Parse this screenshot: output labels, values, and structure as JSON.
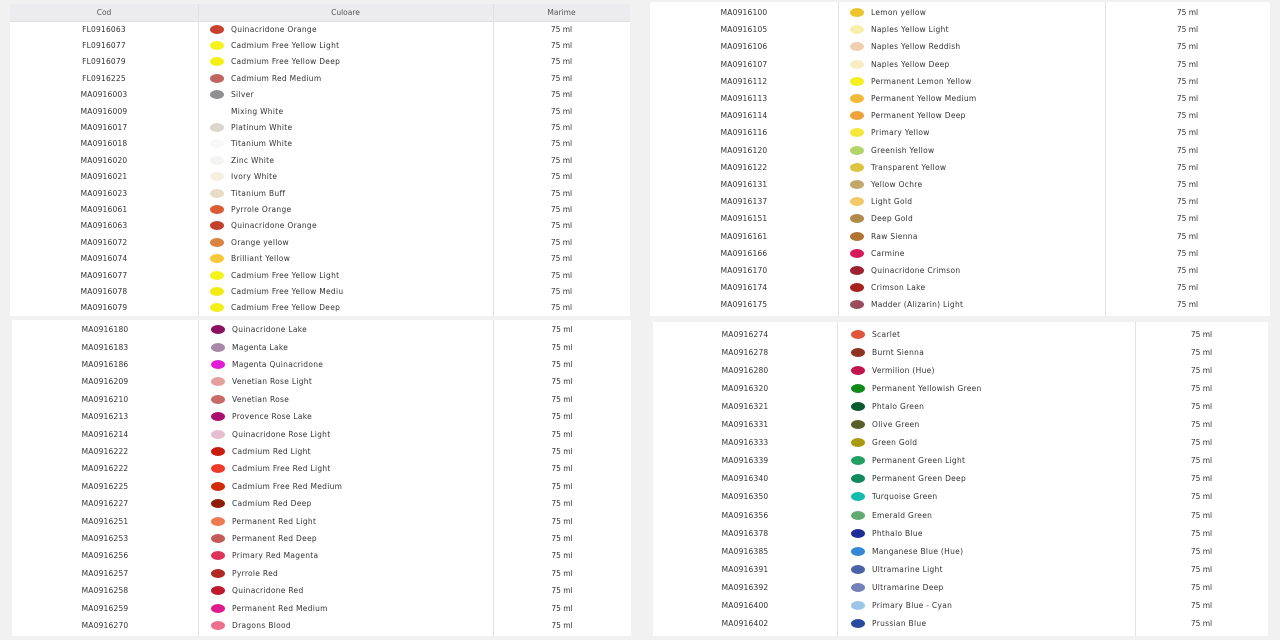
{
  "header": {
    "cod": "Cod",
    "culoare": "Culoare",
    "marime": "Marime"
  },
  "panels": [
    {
      "rows": [
        {
          "cod": "FL0916063",
          "name": "Quinacridone Orange",
          "size": "75 ml",
          "color": "#c8402e"
        },
        {
          "cod": "FL0916077",
          "name": "Cadmium Free Yellow Light",
          "size": "75 ml",
          "color": "#f6f21c"
        },
        {
          "cod": "FL0916079",
          "name": "Cadmium Free Yellow Deep",
          "size": "75 ml",
          "color": "#f4f016"
        },
        {
          "cod": "FL0916225",
          "name": "Cadmium Red Medium",
          "size": "75 ml",
          "color": "#bf6460"
        },
        {
          "cod": "MA0916003",
          "name": "Silver",
          "size": "75 ml",
          "color": "#8f8f93"
        },
        {
          "cod": "MA0916009",
          "name": "Mixing White",
          "size": "75 ml",
          "color": "#ffffff"
        },
        {
          "cod": "MA0916017",
          "name": "Platinum White",
          "size": "75 ml",
          "color": "#dcd6cc"
        },
        {
          "cod": "MA0916018",
          "name": "Titanium White",
          "size": "75 ml",
          "color": "#f8f8f8"
        },
        {
          "cod": "MA0916020",
          "name": "Zinc White",
          "size": "75 ml",
          "color": "#f3f3f1"
        },
        {
          "cod": "MA0916021",
          "name": "Ivory White",
          "size": "75 ml",
          "color": "#f6eee0"
        },
        {
          "cod": "MA0916023",
          "name": "Titanium Buff",
          "size": "75 ml",
          "color": "#e8dcc4"
        },
        {
          "cod": "MA0916061",
          "name": "Pyrrole Orange",
          "size": "75 ml",
          "color": "#dc5a36"
        },
        {
          "cod": "MA0916063",
          "name": "Quinacridone Orange",
          "size": "75 ml",
          "color": "#c2402c"
        },
        {
          "cod": "MA0916072",
          "name": "Orange yellow",
          "size": "75 ml",
          "color": "#d98440"
        },
        {
          "cod": "MA0916074",
          "name": "Brilliant Yellow",
          "size": "75 ml",
          "color": "#f8c838"
        },
        {
          "cod": "MA0916077",
          "name": "Cadmium Free Yellow Light",
          "size": "75 ml",
          "color": "#f6f21c"
        },
        {
          "cod": "MA0916078",
          "name": "Cadmium Free Yellow Mediu",
          "size": "75 ml",
          "color": "#f2ea14"
        },
        {
          "cod": "MA0916079",
          "name": "Cadmium Free Yellow Deep",
          "size": "75 ml",
          "color": "#f4ee18"
        }
      ]
    },
    {
      "rows": [
        {
          "cod": "MA0916100",
          "name": "Lemon yellow",
          "size": "75 ml",
          "color": "#ebc62a"
        },
        {
          "cod": "MA0916105",
          "name": "Naples Yellow Light",
          "size": "75 ml",
          "color": "#f8f0a8"
        },
        {
          "cod": "MA0916106",
          "name": "Naples Yellow Reddish",
          "size": "75 ml",
          "color": "#f0ceb0"
        },
        {
          "cod": "MA0916107",
          "name": "Naples Yellow Deep",
          "size": "75 ml",
          "color": "#f8ecc4"
        },
        {
          "cod": "MA0916112",
          "name": "Permanent Lemon Yellow",
          "size": "75 ml",
          "color": "#f5ee20"
        },
        {
          "cod": "MA0916113",
          "name": "Permanent Yellow Medium",
          "size": "75 ml",
          "color": "#f2b83a"
        },
        {
          "cod": "MA0916114",
          "name": "Permanent Yellow Deep",
          "size": "75 ml",
          "color": "#f0a23a"
        },
        {
          "cod": "MA0916116",
          "name": "Primary Yellow",
          "size": "75 ml",
          "color": "#f6e83a"
        },
        {
          "cod": "MA0916120",
          "name": "Greenish Yellow",
          "size": "75 ml",
          "color": "#b2d46a"
        },
        {
          "cod": "MA0916122",
          "name": "Transparent Yellow",
          "size": "75 ml",
          "color": "#dcc440"
        },
        {
          "cod": "MA0916131",
          "name": "Yellow Ochre",
          "size": "75 ml",
          "color": "#c2a86a"
        },
        {
          "cod": "MA0916137",
          "name": "Light Gold",
          "size": "75 ml",
          "color": "#f2c868"
        },
        {
          "cod": "MA0916151",
          "name": "Deep Gold",
          "size": "75 ml",
          "color": "#b08a48"
        },
        {
          "cod": "MA0916161",
          "name": "Raw Sienna",
          "size": "75 ml",
          "color": "#b07432"
        },
        {
          "cod": "MA0916166",
          "name": "Carmine",
          "size": "75 ml",
          "color": "#d41a5a"
        },
        {
          "cod": "MA0916170",
          "name": "Quinacridone Crimson",
          "size": "75 ml",
          "color": "#9c2230"
        },
        {
          "cod": "MA0916174",
          "name": "Crimson Lake",
          "size": "75 ml",
          "color": "#a8221c"
        },
        {
          "cod": "MA0916175",
          "name": "Madder (Alizarin) Light",
          "size": "75 ml",
          "color": "#9a4c5c"
        }
      ]
    },
    {
      "rows": [
        {
          "cod": "MA0916180",
          "name": "Quinacridone Lake",
          "size": "75 ml",
          "color": "#8c1060"
        },
        {
          "cod": "MA0916183",
          "name": "Magenta Lake",
          "size": "75 ml",
          "color": "#a888a8"
        },
        {
          "cod": "MA0916186",
          "name": "Magenta Quinacridone",
          "size": "75 ml",
          "color": "#e01cd8"
        },
        {
          "cod": "MA0916209",
          "name": "Venetian Rose Light",
          "size": "75 ml",
          "color": "#e4a09c"
        },
        {
          "cod": "MA0916210",
          "name": "Venetian Rose",
          "size": "75 ml",
          "color": "#c86a66"
        },
        {
          "cod": "MA0916213",
          "name": "Provence Rose Lake",
          "size": "75 ml",
          "color": "#a81070"
        },
        {
          "cod": "MA0916214",
          "name": "Quinacridone Rose Light",
          "size": "75 ml",
          "color": "#e8bcd0"
        },
        {
          "cod": "MA0916222",
          "name": "Cadmium Red Light",
          "size": "75 ml",
          "color": "#c81c0e"
        },
        {
          "cod": "MA0916222",
          "name": "Cadmium Free Red Light",
          "size": "75 ml",
          "color": "#ee3a28"
        },
        {
          "cod": "MA0916225",
          "name": "Cadmium Free Red Medium",
          "size": "75 ml",
          "color": "#d02a08"
        },
        {
          "cod": "MA0916227",
          "name": "Cadmium Red Deep",
          "size": "75 ml",
          "color": "#8e1e06"
        },
        {
          "cod": "MA0916251",
          "name": "Permanent Red Light",
          "size": "75 ml",
          "color": "#ee7a52"
        },
        {
          "cod": "MA0916253",
          "name": "Permanent Red Deep",
          "size": "75 ml",
          "color": "#c45a58"
        },
        {
          "cod": "MA0916256",
          "name": "Primary Red Magenta",
          "size": "75 ml",
          "color": "#dc3456"
        },
        {
          "cod": "MA0916257",
          "name": "Pyrrole Red",
          "size": "75 ml",
          "color": "#b02a24"
        },
        {
          "cod": "MA0916258",
          "name": "Quinacridone Red",
          "size": "75 ml",
          "color": "#c0182c"
        },
        {
          "cod": "MA0916259",
          "name": "Permanent Red Medium",
          "size": "75 ml",
          "color": "#de1a8c"
        },
        {
          "cod": "MA0916270",
          "name": "Dragons Blood",
          "size": "75 ml",
          "color": "#ee6e8e"
        }
      ]
    },
    {
      "rows": [
        {
          "cod": "MA0916274",
          "name": "Scarlet",
          "size": "75 ml",
          "color": "#e0563a"
        },
        {
          "cod": "MA0916278",
          "name": "Burnt Sienna",
          "size": "75 ml",
          "color": "#8e3222"
        },
        {
          "cod": "MA0916280",
          "name": "Vermilion (Hue)",
          "size": "75 ml",
          "color": "#c4144e"
        },
        {
          "cod": "MA0916320",
          "name": "Permanent Yellowish Green",
          "size": "75 ml",
          "color": "#128a1a"
        },
        {
          "cod": "MA0916321",
          "name": "Phtalo Green",
          "size": "75 ml",
          "color": "#0a5a30"
        },
        {
          "cod": "MA0916331",
          "name": "Olive Green",
          "size": "75 ml",
          "color": "#5a5e2a"
        },
        {
          "cod": "MA0916333",
          "name": "Green Gold",
          "size": "75 ml",
          "color": "#aa9a10"
        },
        {
          "cod": "MA0916339",
          "name": "Permanent Green Light",
          "size": "75 ml",
          "color": "#22a060"
        },
        {
          "cod": "MA0916340",
          "name": "Permanent Green Deep",
          "size": "75 ml",
          "color": "#108a5c"
        },
        {
          "cod": "MA0916350",
          "name": "Turquoise Green",
          "size": "75 ml",
          "color": "#14bcb0"
        },
        {
          "cod": "MA0916356",
          "name": "Emerald Green",
          "size": "75 ml",
          "color": "#62aa72"
        },
        {
          "cod": "MA0916378",
          "name": "Phthalo Blue",
          "size": "75 ml",
          "color": "#1e2e96"
        },
        {
          "cod": "MA0916385",
          "name": "Manganese Blue (Hue)",
          "size": "75 ml",
          "color": "#3488d4"
        },
        {
          "cod": "MA0916391",
          "name": "Ultramarine Light",
          "size": "75 ml",
          "color": "#4a62a8"
        },
        {
          "cod": "MA0916392",
          "name": "Ultramarine Deep",
          "size": "75 ml",
          "color": "#7480b8"
        },
        {
          "cod": "MA0916400",
          "name": "Primary Blue - Cyan",
          "size": "75 ml",
          "color": "#9ec4ea"
        },
        {
          "cod": "MA0916402",
          "name": "Prussian Blue",
          "size": "75 ml",
          "color": "#2a4aa0"
        }
      ]
    }
  ]
}
